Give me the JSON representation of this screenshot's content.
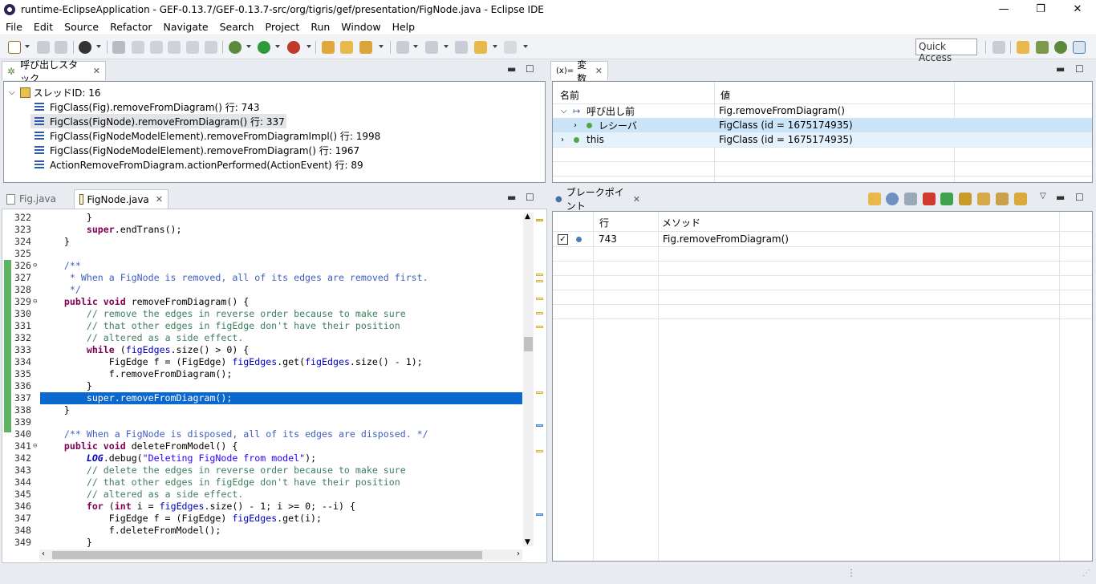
{
  "window": {
    "title": "runtime-EclipseApplication - GEF-0.13.7/GEF-0.13.7-src/org/tigris/gef/presentation/FigNode.java - Eclipse IDE",
    "controls": [
      "—",
      "❐",
      "✕"
    ]
  },
  "menu": [
    "File",
    "Edit",
    "Source",
    "Refactor",
    "Navigate",
    "Search",
    "Project",
    "Run",
    "Window",
    "Help"
  ],
  "toolbar": {
    "quick_access": "Quick Access"
  },
  "callstack": {
    "tab_label": "呼び出しスタック",
    "thread": "スレッドID: 16",
    "frames": [
      "FigClass(Fig).removeFromDiagram() 行: 743",
      "FigClass(FigNode).removeFromDiagram() 行: 337",
      "FigClass(FigNodeModelElement).removeFromDiagramImpl() 行: 1998",
      "FigClass(FigNodeModelElement).removeFromDiagram() 行: 1967",
      "ActionRemoveFromDiagram.actionPerformed(ActionEvent) 行: 89"
    ]
  },
  "variables": {
    "tab_prefix": "(x)=",
    "tab_label": "変数",
    "col_name": "名前",
    "col_value": "値",
    "rows": [
      {
        "name": "呼び出し前",
        "value": "Fig.removeFromDiagram()"
      },
      {
        "name": "レシーバ",
        "value": "FigClass (id = 1675174935)"
      },
      {
        "name": "this",
        "value": "FigClass (id = 1675174935)"
      }
    ]
  },
  "editor": {
    "tabs": [
      "Fig.java",
      "FigNode.java"
    ],
    "lines": [
      {
        "n": "322",
        "h": "        <span>}</span>"
      },
      {
        "n": "323",
        "h": "        <span class=\"kw\">super</span>.endTrans();"
      },
      {
        "n": "324",
        "h": "    }"
      },
      {
        "n": "325",
        "h": ""
      },
      {
        "n": "326",
        "h": "    <span class=\"jd\">/**</span>"
      },
      {
        "n": "327",
        "h": "<span class=\"jd\">     * When a FigNode is removed, all of its edges are removed first.</span>"
      },
      {
        "n": "328",
        "h": "<span class=\"jd\">     */</span>"
      },
      {
        "n": "329",
        "h": "    <span class=\"kw\">public</span> <span class=\"kw\">void</span> removeFromDiagram() {"
      },
      {
        "n": "330",
        "h": "        <span class=\"cm\">// remove the edges in reverse order because to make sure</span>"
      },
      {
        "n": "331",
        "h": "        <span class=\"cm\">// that other edges in figEdge don't have their position</span>"
      },
      {
        "n": "332",
        "h": "        <span class=\"cm\">// altered as a side effect.</span>"
      },
      {
        "n": "333",
        "h": "        <span class=\"kw\">while</span> (<span class=\"fld\">figEdges</span>.size() &gt; 0) {"
      },
      {
        "n": "334",
        "h": "            FigEdge f = (FigEdge) <span class=\"fld\">figEdges</span>.get(<span class=\"fld\">figEdges</span>.size() - 1);"
      },
      {
        "n": "335",
        "h": "            f.removeFromDiagram();"
      },
      {
        "n": "336",
        "h": "        }"
      },
      {
        "n": "337",
        "h": "        super.removeFromDiagram();"
      },
      {
        "n": "338",
        "h": "    }"
      },
      {
        "n": "339",
        "h": ""
      },
      {
        "n": "340",
        "h": "    <span class=\"jd\">/** When a FigNode is disposed, all of its edges are disposed. */</span>"
      },
      {
        "n": "341",
        "h": "    <span class=\"kw\">public</span> <span class=\"kw\">void</span> deleteFromModel() {"
      },
      {
        "n": "342",
        "h": "        <span class=\"st-it\">LOG</span>.debug(<span class=\"str\">\"Deleting FigNode from model\"</span>);"
      },
      {
        "n": "343",
        "h": "        <span class=\"cm\">// delete the edges in reverse order because to make sure</span>"
      },
      {
        "n": "344",
        "h": "        <span class=\"cm\">// that other edges in figEdge don't have their position</span>"
      },
      {
        "n": "345",
        "h": "        <span class=\"cm\">// altered as a side effect.</span>"
      },
      {
        "n": "346",
        "h": "        <span class=\"kw\">for</span> (<span class=\"kw\">int</span> i = <span class=\"fld\">figEdges</span>.size() - 1; i &gt;= 0; --i) {"
      },
      {
        "n": "347",
        "h": "            FigEdge f = (FigEdge) <span class=\"fld\">figEdges</span>.get(i);"
      },
      {
        "n": "348",
        "h": "            f.deleteFromModel();"
      },
      {
        "n": "349",
        "h": "        }"
      }
    ]
  },
  "breakpoints": {
    "tab_label": "ブレークポイント",
    "col_line": "行",
    "col_method": "メソッド",
    "rows": [
      {
        "line": "743",
        "method": "Fig.removeFromDiagram()"
      }
    ]
  }
}
